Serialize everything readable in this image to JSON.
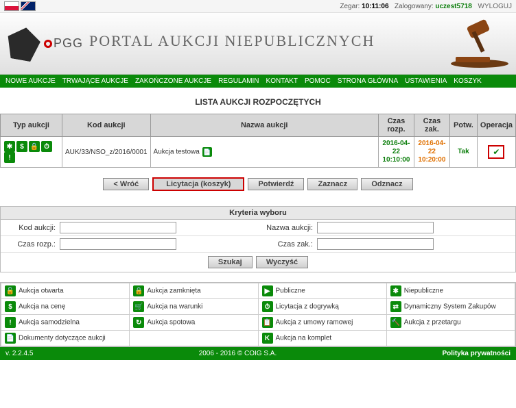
{
  "top": {
    "clock_label": "Zegar:",
    "clock": "10:11:06",
    "logged_label": "Zalogowany:",
    "user": "uczest5718",
    "logout": "WYLOGUJ"
  },
  "brand": {
    "name": "PGG",
    "title": "PORTAL AUKCJI NIEPUBLICZNYCH"
  },
  "nav": [
    "NOWE AUKCJE",
    "TRWAJĄCE AUKCJE",
    "ZAKOŃCZONE AUKCJE",
    "REGULAMIN",
    "KONTAKT",
    "POMOC",
    "STRONA GŁÓWNA",
    "USTAWIENIA",
    "KOSZYK"
  ],
  "section_title": "LISTA AUKCJI ROZPOCZĘTYCH",
  "table": {
    "cols": [
      "Typ aukcji",
      "Kod aukcji",
      "Nazwa aukcji",
      "Czas rozp.",
      "Czas zak.",
      "Potw.",
      "Operacja"
    ],
    "row": {
      "type_icons": [
        "✱",
        "$",
        "🔒",
        "⏱",
        "!"
      ],
      "kod": "AUK/33/NSO_z/2016/0001",
      "nazwa": "Aukcja testowa",
      "rozp": "2016-04-22 10:10:00",
      "zak": "2016-04-22 10:20:00",
      "potw": "Tak"
    }
  },
  "buttons": {
    "back": "< Wróć",
    "licytacja": "Licytacja (koszyk)",
    "potwierdz": "Potwierdź",
    "zaznacz": "Zaznacz",
    "odznacz": "Odznacz"
  },
  "criteria": {
    "title": "Kryteria wyboru",
    "kod_label": "Kod aukcji:",
    "nazwa_label": "Nazwa aukcji:",
    "rozp_label": "Czas rozp.:",
    "zak_label": "Czas zak.:",
    "szukaj": "Szukaj",
    "wyczysc": "Wyczyść"
  },
  "legend": [
    [
      {
        "i": "🔓",
        "t": "Aukcja otwarta"
      },
      {
        "i": "🔒",
        "t": "Aukcja zamknięta"
      },
      {
        "i": "▶",
        "t": "Publiczne"
      },
      {
        "i": "✱",
        "t": "Niepubliczne"
      }
    ],
    [
      {
        "i": "$",
        "t": "Aukcja na cenę"
      },
      {
        "i": "🛒",
        "t": "Aukcja na warunki"
      },
      {
        "i": "⏱",
        "t": "Licytacja z dogrywką"
      },
      {
        "i": "⇄",
        "t": "Dynamiczny System Zakupów"
      }
    ],
    [
      {
        "i": "!",
        "t": "Aukcja samodzielna"
      },
      {
        "i": "↻",
        "t": "Aukcja spotowa"
      },
      {
        "i": "📋",
        "t": "Aukcja z umowy ramowej"
      },
      {
        "i": "🔨",
        "t": "Aukcja z przetargu"
      }
    ],
    [
      {
        "i": "📄",
        "t": "Dokumenty dotyczące aukcji"
      },
      {
        "i": "",
        "t": ""
      },
      {
        "i": "K",
        "t": "Aukcja na komplet"
      },
      {
        "i": "",
        "t": ""
      }
    ]
  ],
  "footer": {
    "ver": "v. 2.2.4.5",
    "mid": "2006 - 2016 © COIG S.A.",
    "priv": "Polityka prywatności"
  }
}
